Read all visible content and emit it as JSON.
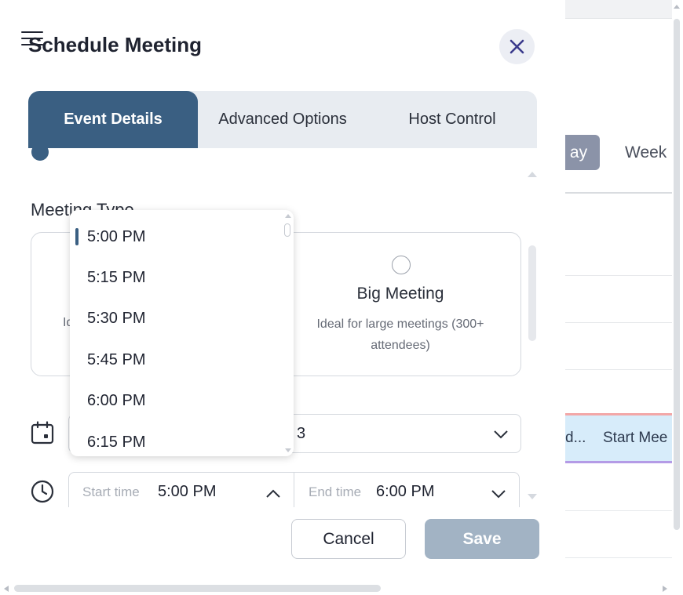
{
  "modal": {
    "title": "Schedule Meeting",
    "tabs": [
      {
        "label": "Event Details",
        "active": true
      },
      {
        "label": "Advanced Options",
        "active": false
      },
      {
        "label": "Host Control",
        "active": false
      }
    ],
    "meeting_type_label": "Meeting Type",
    "small_meeting_desc_fragment": "Id",
    "big_meeting": {
      "title": "Big Meeting",
      "description": "Ideal for large meetings (300+ attendees)"
    },
    "date_value_fragment": "3",
    "start_time": {
      "label": "Start time",
      "value": "5:00 PM"
    },
    "end_time": {
      "label": "End time",
      "value": "6:00 PM"
    },
    "cancel_label": "Cancel",
    "save_label": "Save"
  },
  "time_dropdown": {
    "options": [
      "5:00 PM",
      "5:15 PM",
      "5:30 PM",
      "5:45 PM",
      "6:00 PM",
      "6:15 PM"
    ],
    "selected": "5:00 PM"
  },
  "background": {
    "day_label": "ay",
    "week_label": "Week",
    "event_fragment": "d...",
    "event_label": "Start Mee"
  },
  "colors": {
    "accent": "#3a5f82",
    "save_disabled": "#a2b3c4",
    "close_icon": "#3b3a8c"
  }
}
